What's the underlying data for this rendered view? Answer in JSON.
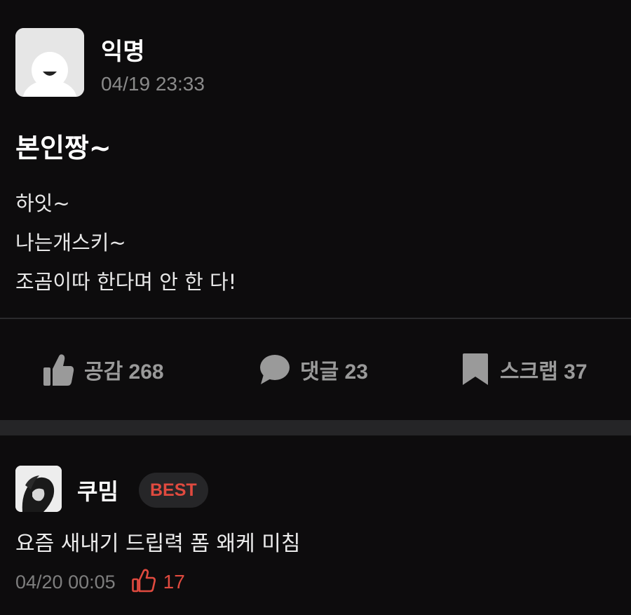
{
  "post": {
    "author": "익명",
    "timestamp": "04/19 23:33",
    "title": "본인짱~",
    "body_lines": [
      "하잇~",
      "나는개스키~",
      "조곰이따 한다며 안 한 다!"
    ]
  },
  "actions": {
    "like_label": "공감 268",
    "comment_label": "댓글 23",
    "scrap_label": "스크랩 37"
  },
  "icons": {
    "post_avatar": "anonymous-avatar-icon",
    "like": "thumbs-up-icon",
    "comment": "speech-bubble-icon",
    "scrap": "bookmark-icon"
  },
  "comment": {
    "author": "쿠밈",
    "badge": "BEST",
    "text": "요즘 새내기 드립력 폼 왜케 미침",
    "timestamp": "04/20 00:05",
    "likes": "17"
  },
  "colors": {
    "background": "#0d0c0d",
    "accent_red": "#e04a3f",
    "muted_gray": "#9a9a9a"
  }
}
